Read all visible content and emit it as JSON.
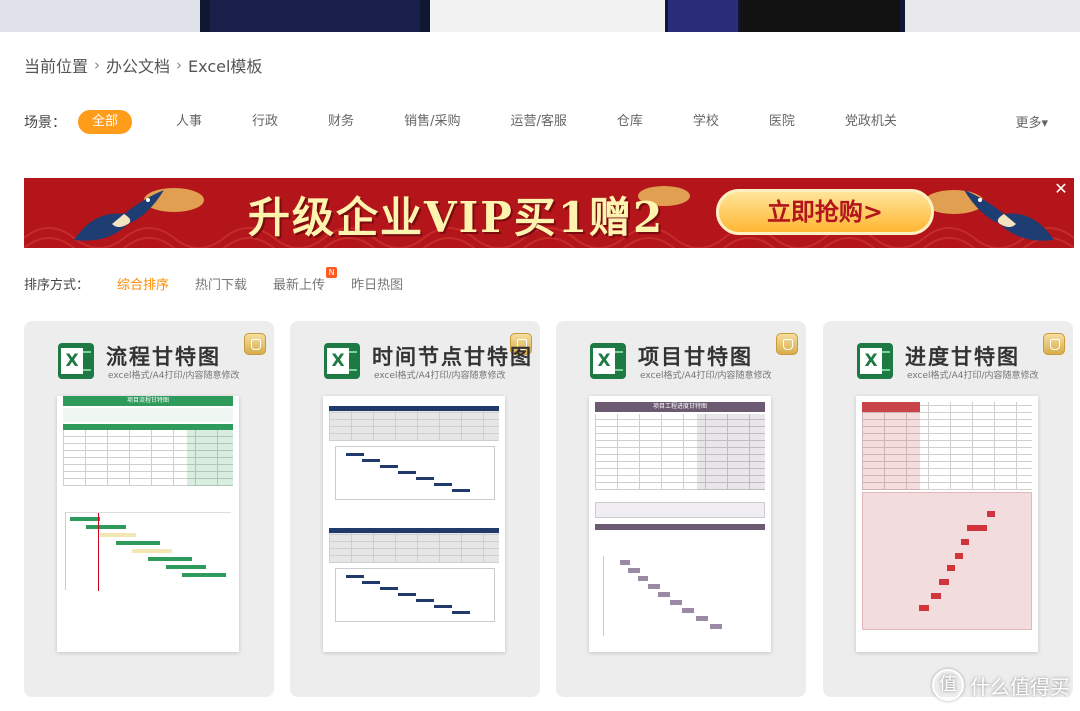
{
  "breadcrumb": {
    "items": [
      "当前位置",
      "办公文档",
      "Excel模板"
    ]
  },
  "scene": {
    "label": "场景：",
    "chips": [
      "全部",
      "人事",
      "行政",
      "财务",
      "销售/采购",
      "运营/客服",
      "仓库",
      "学校",
      "医院",
      "党政机关"
    ],
    "active_index": 0,
    "more": "更多▾"
  },
  "banner": {
    "headline": "升级企业VIP买1赠2",
    "cta": "立即抢购>",
    "close": "✕"
  },
  "sort": {
    "label": "排序方式：",
    "options": [
      "综合排序",
      "热门下载",
      "最新上传",
      "昨日热图"
    ],
    "active_index": 0,
    "new_badge": "N"
  },
  "cards": [
    {
      "title": "流程甘特图",
      "subtitle": "excel格式/A4打印/内容随意修改",
      "doc_heading": "项目流程甘特图",
      "accent": "#2e9a5b"
    },
    {
      "title": "时间节点甘特图",
      "subtitle": "excel格式/A4打印/内容随意修改",
      "accent": "#1f3a6b"
    },
    {
      "title": "项目甘特图",
      "subtitle": "excel格式/A4打印/内容随意修改",
      "doc_heading": "项目工程进度甘特图",
      "accent": "#6b5a72"
    },
    {
      "title": "进度甘特图",
      "subtitle": "excel格式/A4打印/内容随意修改",
      "accent": "#c9434a"
    }
  ],
  "watermark": {
    "text": "什么值得买",
    "icon": "值"
  },
  "colors": {
    "accent_orange": "#ff9c1a",
    "banner_red": "#b3151b",
    "excel_green": "#1e7a44"
  }
}
